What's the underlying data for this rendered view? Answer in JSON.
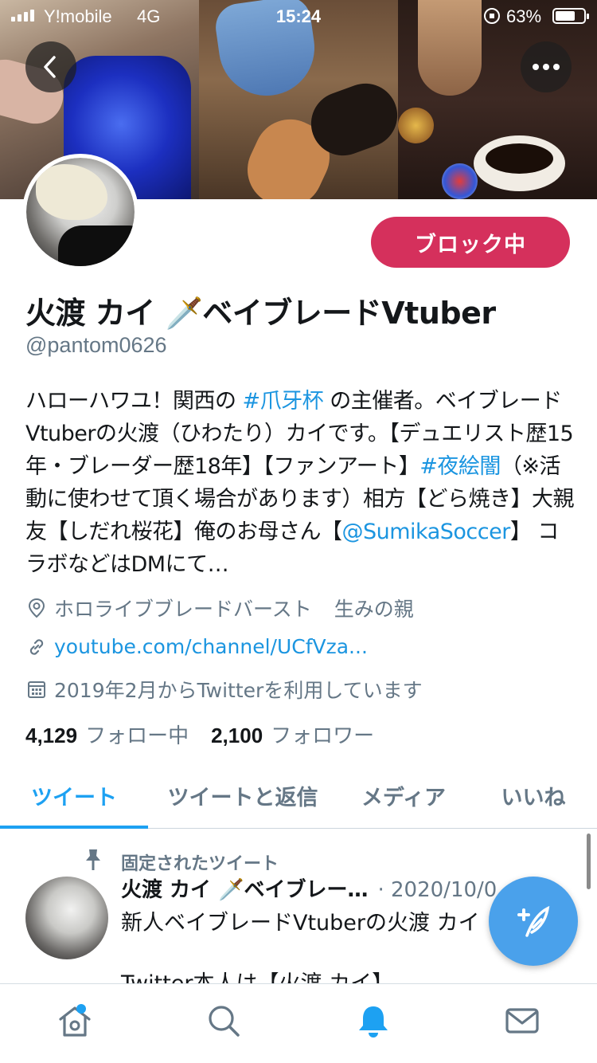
{
  "status_bar": {
    "carrier": "Y!mobile",
    "network": "4G",
    "time": "15:24",
    "battery": "63%"
  },
  "profile": {
    "name": "火渡 カイ 🗡️ベイブレードVtuber",
    "handle": "@pantom0626",
    "action_button": "ブロック中",
    "bio": {
      "t1": "ハローハワユ！関西の ",
      "l1": "#爪牙杯",
      "t2": " の主催者。ベイブレードVtuberの火渡（ひわたり）カイです。【デュエリスト歴15年・ブレーダー歴18年】【ファンアート】",
      "l2": "#夜絵闇",
      "t3": "（※活動に使わせて頂く場合があります）相方【どら焼き】大親友【しだれ桜花】俺のお母さん【",
      "l3": "@SumikaSoccer",
      "t4": "】 コラボなどはDMにて…"
    },
    "location": "ホロライブブレードバースト",
    "location_extra": "生みの親",
    "website": "youtube.com/channel/UCfVza...",
    "joined": "2019年2月からTwitterを利用しています",
    "following_count": "4,129",
    "following_label": "フォロー中",
    "followers_count": "2,100",
    "followers_label": "フォロワー"
  },
  "tabs": [
    {
      "label": "ツイート"
    },
    {
      "label": "ツイートと返信"
    },
    {
      "label": "メディア"
    },
    {
      "label": "いいね"
    }
  ],
  "pinned_tweet": {
    "pinned_label": "固定されたツイート",
    "author": "火渡 カイ 🗡️ベイブレー…",
    "date": "· 2020/10/0",
    "text_line1": "新人ベイブレードVtuberの火渡 カイ",
    "text_line2": "Twitter本人は【火渡 カイ】"
  },
  "colors": {
    "accent": "#1da1f2",
    "blocked": "#d5305c",
    "muted": "#657786",
    "fab": "#4aa1eb"
  },
  "icons": {
    "back": "chevron-left-icon",
    "more": "more-dots-icon",
    "location": "location-pin-icon",
    "link": "link-icon",
    "calendar": "calendar-icon",
    "pin": "pin-icon",
    "compose": "compose-feather-icon",
    "nav": [
      "home-icon",
      "search-icon",
      "bell-icon",
      "mail-icon"
    ]
  }
}
